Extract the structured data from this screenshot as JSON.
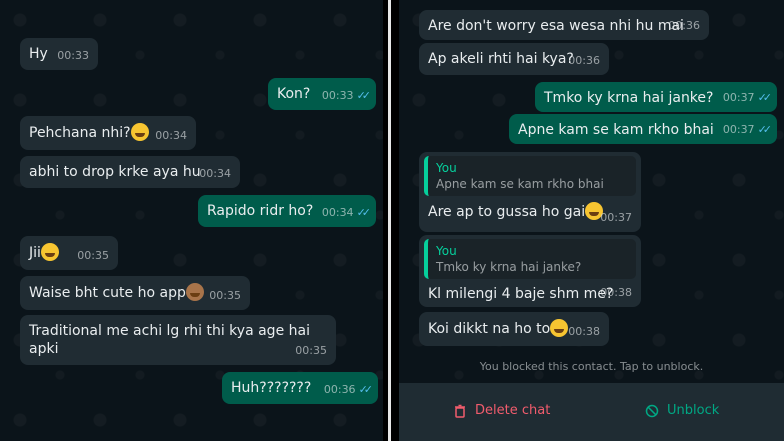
{
  "left_chat": {
    "messages": [
      {
        "dir": "in",
        "text": "Hy",
        "time": "00:33"
      },
      {
        "dir": "out",
        "text": "Kon?",
        "time": "00:33"
      },
      {
        "dir": "in",
        "text": "Pehchana nhi?",
        "time": "00:34",
        "emoji": "grin-sweat-emoji"
      },
      {
        "dir": "in",
        "text": "abhi to drop krke aya hu",
        "time": "00:34"
      },
      {
        "dir": "out",
        "text": "Rapido ridr ho?",
        "time": "00:34"
      },
      {
        "dir": "in",
        "text": "Jii",
        "time": "00:35",
        "emoji": "grin-sweat-emoji"
      },
      {
        "dir": "in",
        "text": "Waise bht cute ho app",
        "time": "00:35",
        "emoji": "see-no-evil-monkey-emoji"
      },
      {
        "dir": "in",
        "text": "Traditional me achi lg rhi thi kya age hai apki",
        "time": "00:35"
      },
      {
        "dir": "out",
        "text": "Huh???????",
        "time": "00:36"
      }
    ]
  },
  "right_chat": {
    "messages": [
      {
        "dir": "in",
        "text": "Are don't worry esa wesa nhi hu mai",
        "time": "00:36"
      },
      {
        "dir": "in",
        "text": "Ap akeli rhti hai kya?",
        "time": "00:36"
      },
      {
        "dir": "out",
        "text": "Tmko ky krna hai janke?",
        "time": "00:37"
      },
      {
        "dir": "out",
        "text": "Apne kam se kam rkho bhai",
        "time": "00:37"
      },
      {
        "dir": "in",
        "quote_author": "You",
        "quote_text": "Apne kam se kam rkho bhai",
        "text": "Are ap to gussa ho gai",
        "time": "00:37",
        "emoji": "grin-sweat-emoji"
      },
      {
        "dir": "in",
        "quote_author": "You",
        "quote_text": "Tmko ky krna hai janke?",
        "text": "Kl milengi 4 baje shm me?",
        "time": "00:38"
      },
      {
        "dir": "in",
        "text": "Koi dikkt na ho to",
        "time": "00:38",
        "emoji": "grin-sweat-emoji"
      }
    ],
    "blocked_notice": "You blocked this contact. Tap to unblock.",
    "delete_label": "Delete chat",
    "unblock_label": "Unblock"
  },
  "colors": {
    "incoming_bubble": "#202c33",
    "outgoing_bubble": "#005c4b",
    "read_tick": "#53bdeb",
    "delete_red": "#f15c6d",
    "unblock_green": "#00a884"
  },
  "icons": {
    "read_receipt": "double-check-icon",
    "delete": "trash-icon",
    "unblock": "block-circle-icon"
  }
}
